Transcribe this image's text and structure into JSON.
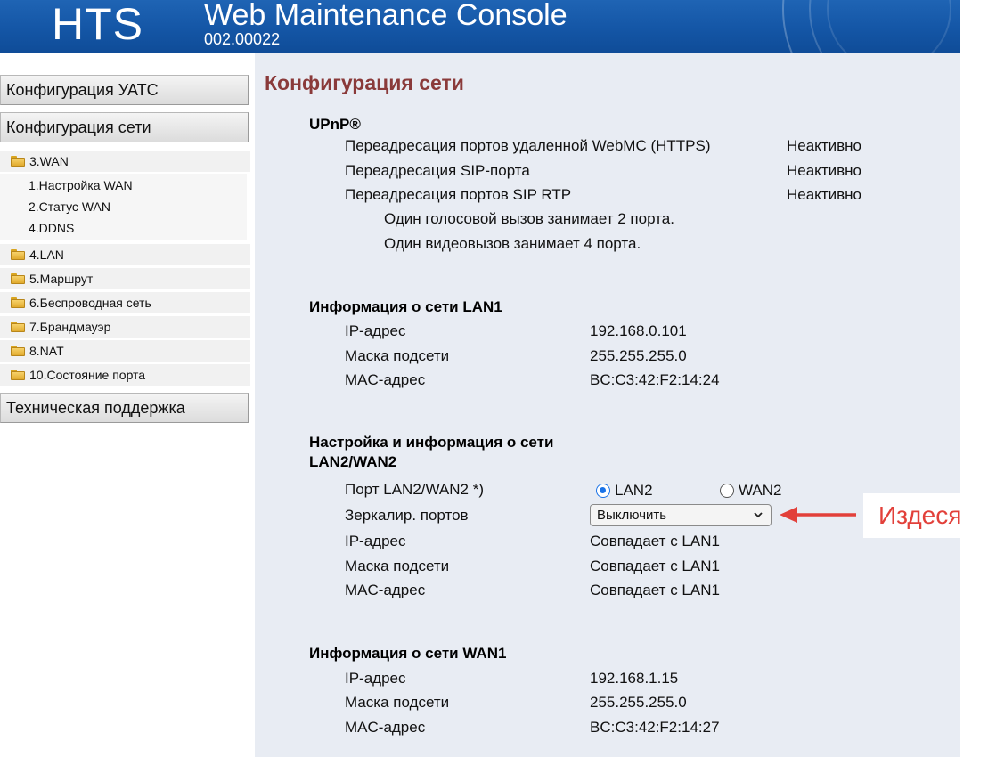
{
  "header": {
    "brand": "HTS",
    "title": "Web Maintenance Console",
    "version": "002.00022"
  },
  "sidebar": {
    "pbx_config": "Конфигурация УАТС",
    "network_config": "Конфигурация сети",
    "tree": {
      "wan": "3.WAN",
      "wan_items": [
        "1.Настройка WAN",
        "2.Статус WAN",
        "4.DDNS"
      ],
      "lan": "4.LAN",
      "route": "5.Маршрут",
      "wireless": "6.Беспроводная сеть",
      "firewall": "7.Брандмауэр",
      "nat": "8.NAT",
      "port_status": "10.Состояние порта"
    },
    "support": "Техническая поддержка"
  },
  "main": {
    "page_title": "Конфигурация сети",
    "upnp": {
      "heading": "UPnP®",
      "rows": [
        {
          "label": "Переадресация портов удаленной WebMC (HTTPS)",
          "value": "Неактивно"
        },
        {
          "label": "Переадресация SIP-порта",
          "value": "Неактивно"
        },
        {
          "label": "Переадресация портов SIP RTP",
          "value": "Неактивно"
        }
      ],
      "notes": [
        "Один голосовой вызов занимает 2 порта.",
        "Один видеовызов занимает 4 порта."
      ]
    },
    "lan1": {
      "heading": "Информация о сети LAN1",
      "rows": [
        {
          "label": "IP-адрес",
          "value": "192.168.0.101"
        },
        {
          "label": "Маска подсети",
          "value": "255.255.255.0"
        },
        {
          "label": "MAC-адрес",
          "value": "BC:C3:42:F2:14:24"
        }
      ]
    },
    "lan2wan2": {
      "heading_line1": "Настройка и информация о сети",
      "heading_line2": "LAN2/WAN2",
      "port_label": "Порт LAN2/WAN2 *)",
      "radio_lan2": "LAN2",
      "radio_wan2": "WAN2",
      "selected": "LAN2",
      "mirror_label": "Зеркалир. портов",
      "mirror_value": "Выключить",
      "rows": [
        {
          "label": "IP-адрес",
          "value": "Совпадает с LAN1"
        },
        {
          "label": "Маска подсети",
          "value": "Совпадает с LAN1"
        },
        {
          "label": "MAC-адрес",
          "value": "Совпадает с LAN1"
        }
      ]
    },
    "wan1": {
      "heading": "Информация о сети WAN1",
      "rows": [
        {
          "label": "IP-адрес",
          "value": "192.168.1.15"
        },
        {
          "label": "Маска подсети",
          "value": "255.255.255.0"
        },
        {
          "label": "MAC-адрес",
          "value": "BC:C3:42:F2:14:27"
        }
      ]
    }
  },
  "annotation": {
    "text": "Издеся",
    "color": "#e2403a"
  },
  "colors": {
    "header_blue": "#1456a6",
    "title_red": "#8a3a3a",
    "content_bg": "#e8ecf3"
  }
}
